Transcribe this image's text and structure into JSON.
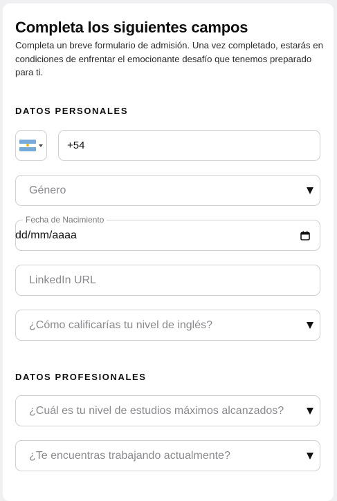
{
  "header": {
    "title": "Completa los siguientes campos",
    "intro": "Completa un breve formulario de admisión. Una vez completado, estarás en condiciones de enfrentar el emocionante desafío que tenemos preparado para ti."
  },
  "personal": {
    "section_title": "DATOS PERSONALES",
    "phone": {
      "country_icon": "argentina-flag-icon",
      "value": "+54"
    },
    "gender": {
      "placeholder": "Género"
    },
    "birthdate": {
      "label": "Fecha de Nacimiento",
      "value": "dd/mm/aaaa"
    },
    "linkedin": {
      "placeholder": "LinkedIn URL"
    },
    "english_level": {
      "placeholder": "¿Cómo calificarías tu nivel de inglés?"
    }
  },
  "professional": {
    "section_title": "DATOS PROFESIONALES",
    "education": {
      "placeholder": "¿Cuál es tu nivel de estudios máximos alcanzados?"
    },
    "working": {
      "placeholder": "¿Te encuentras trabajando actualmente?"
    }
  },
  "colors": {
    "flag_blue": "#75aadb",
    "flag_sun": "#f6b40e",
    "border": "#cfcfd3"
  }
}
